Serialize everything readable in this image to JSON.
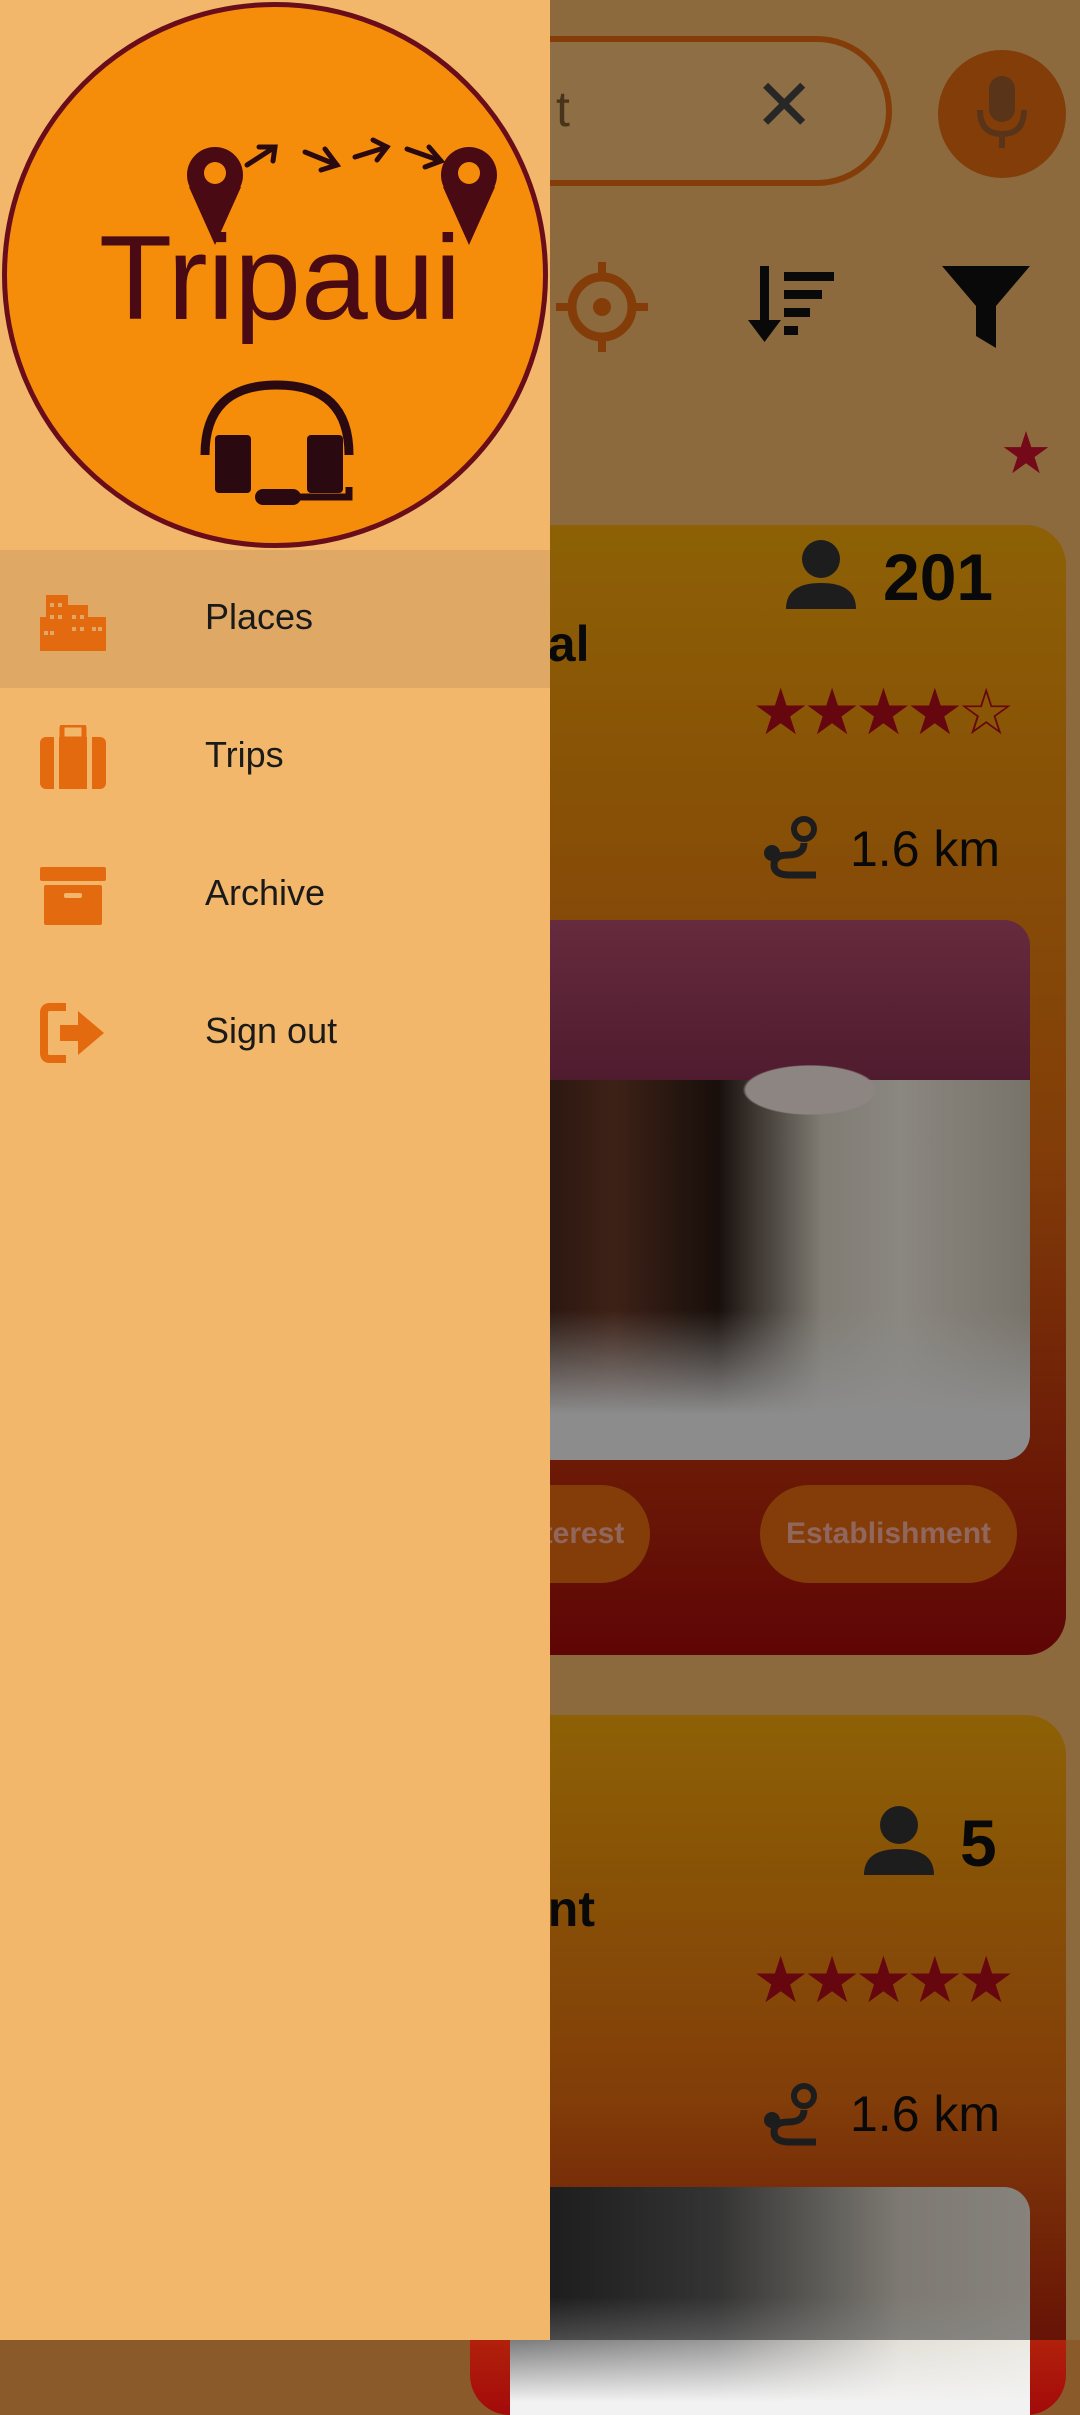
{
  "app": {
    "logo_text": "Tripaui"
  },
  "drawer": {
    "items": [
      {
        "label": "Places",
        "icon": "city-icon",
        "active": true
      },
      {
        "label": "Trips",
        "icon": "suitcase-icon",
        "active": false
      },
      {
        "label": "Archive",
        "icon": "archive-box-icon",
        "active": false
      },
      {
        "label": "Sign out",
        "icon": "sign-out-icon",
        "active": false
      }
    ]
  },
  "search": {
    "value": "t"
  },
  "cards": [
    {
      "name": "ristal",
      "visitors": "201",
      "rating": 4.5,
      "distance": "1.6 km",
      "chips": [
        "t Of Interest",
        "Establishment"
      ]
    },
    {
      "name": "urant",
      "visitors": "5",
      "rating": 5,
      "distance": "1.6 km"
    }
  ],
  "colors": {
    "accent": "#e46a10",
    "drawer_bg": "#f2b76a",
    "star": "#b00c1b",
    "logo_orange": "#f58d0a",
    "logo_dark": "#6a0d1a"
  }
}
